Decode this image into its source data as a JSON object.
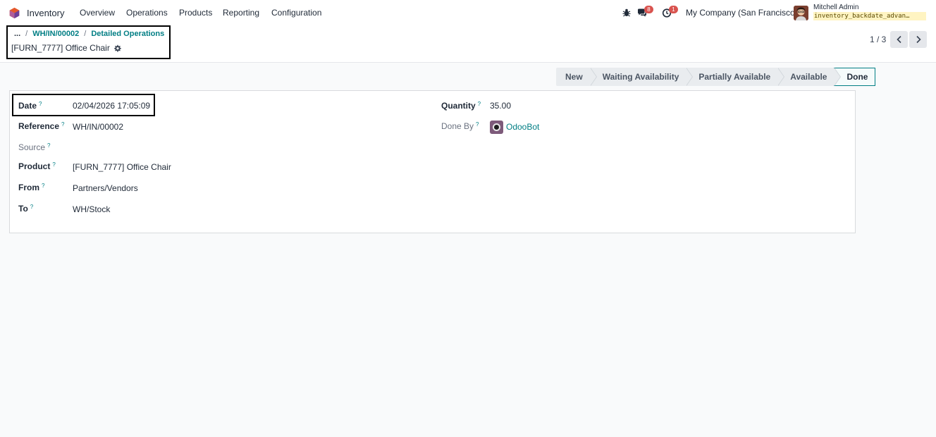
{
  "navbar": {
    "app_name": "Inventory",
    "menu": [
      "Overview",
      "Operations",
      "Products",
      "Reporting",
      "Configuration"
    ],
    "messages_count": "8",
    "activities_count": "1",
    "company": "My Company (San Francisco)",
    "user_name": "Mitchell Admin",
    "database": "inventory_backdate_advan…"
  },
  "breadcrumb": {
    "ellipsis": "...",
    "items": [
      "WH/IN/00002",
      "Detailed Operations"
    ],
    "record_title": "[FURN_7777] Office Chair"
  },
  "pager": {
    "value": "1 / 3"
  },
  "statusbar": {
    "stages": [
      "New",
      "Waiting Availability",
      "Partially Available",
      "Available",
      "Done"
    ],
    "current": "Done"
  },
  "form": {
    "help_mark": "?",
    "date": {
      "label": "Date",
      "value": "02/04/2026 17:05:09"
    },
    "reference": {
      "label": "Reference",
      "value": "WH/IN/00002"
    },
    "source": {
      "label": "Source",
      "value": ""
    },
    "product": {
      "label": "Product",
      "value": "[FURN_7777] Office Chair"
    },
    "from": {
      "label": "From",
      "value": "Partners/Vendors"
    },
    "to": {
      "label": "To",
      "value": "WH/Stock"
    },
    "quantity": {
      "label": "Quantity",
      "value": "35.00"
    },
    "done_by": {
      "label": "Done By",
      "value": "OdooBot"
    }
  },
  "colors": {
    "accent": "#017e84",
    "badge": "#d9534f",
    "highlight_border": "#000000"
  },
  "icons": {
    "app": "inventory-app-icon",
    "debug": "bug-icon",
    "messages": "chat-icon",
    "activities": "clock-icon",
    "record_settings": "gear-icon",
    "pager_prev": "chevron-left-icon",
    "pager_next": "chevron-right-icon"
  }
}
